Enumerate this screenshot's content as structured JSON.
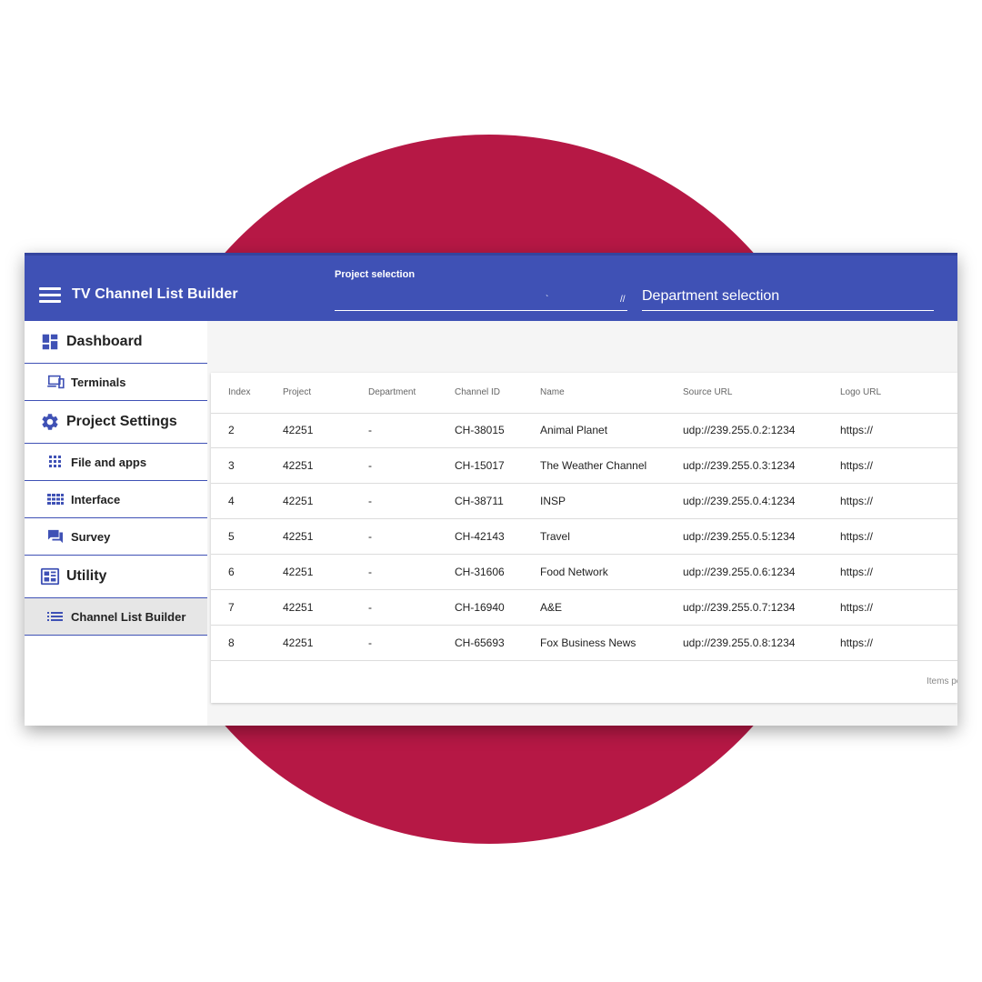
{
  "colors": {
    "primary": "#3f51b5",
    "circle": "#b61845",
    "active_bg": "#e6e6e6"
  },
  "app": {
    "title": "TV Channel List Builder",
    "menu_icon": "hamburger-menu-icon",
    "project_selection": {
      "label": "Project selection",
      "mark1": "`",
      "mark2": "//"
    },
    "department_selection": {
      "value": "Department selection"
    }
  },
  "sidebar": {
    "dashboard": {
      "label": "Dashboard",
      "icon": "dashboard-icon"
    },
    "terminals": {
      "label": "Terminals",
      "icon": "devices-icon"
    },
    "project_settings": {
      "label": "Project Settings",
      "icon": "gear-icon"
    },
    "file_and_apps": {
      "label": "File and apps",
      "icon": "apps-grid-icon"
    },
    "interface": {
      "label": "Interface",
      "icon": "grid-icon"
    },
    "survey": {
      "label": "Survey",
      "icon": "chat-icon"
    },
    "utility": {
      "label": "Utility",
      "icon": "utility-icon"
    },
    "channel_list_builder": {
      "label": "Channel List Builder",
      "icon": "list-icon"
    }
  },
  "table": {
    "headers": [
      "Index",
      "Project",
      "Department",
      "Channel ID",
      "Name",
      "Source URL",
      "Logo URL"
    ],
    "rows": [
      [
        "2",
        "42251",
        "-",
        "CH-38015",
        "Animal Planet",
        "udp://239.255.0.2:1234",
        "https://"
      ],
      [
        "3",
        "42251",
        "-",
        "CH-15017",
        "The Weather Channel",
        "udp://239.255.0.3:1234",
        "https://"
      ],
      [
        "4",
        "42251",
        "-",
        "CH-38711",
        "INSP",
        "udp://239.255.0.4:1234",
        "https://"
      ],
      [
        "5",
        "42251",
        "-",
        "CH-42143",
        "Travel",
        "udp://239.255.0.5:1234",
        "https://"
      ],
      [
        "6",
        "42251",
        "-",
        "CH-31606",
        "Food Network",
        "udp://239.255.0.6:1234",
        "https://"
      ],
      [
        "7",
        "42251",
        "-",
        "CH-16940",
        "A&E",
        "udp://239.255.0.7:1234",
        "https://"
      ],
      [
        "8",
        "42251",
        "-",
        "CH-65693",
        "Fox Business News",
        "udp://239.255.0.8:1234",
        "https://"
      ]
    ],
    "items_per_page": "Items pe"
  }
}
